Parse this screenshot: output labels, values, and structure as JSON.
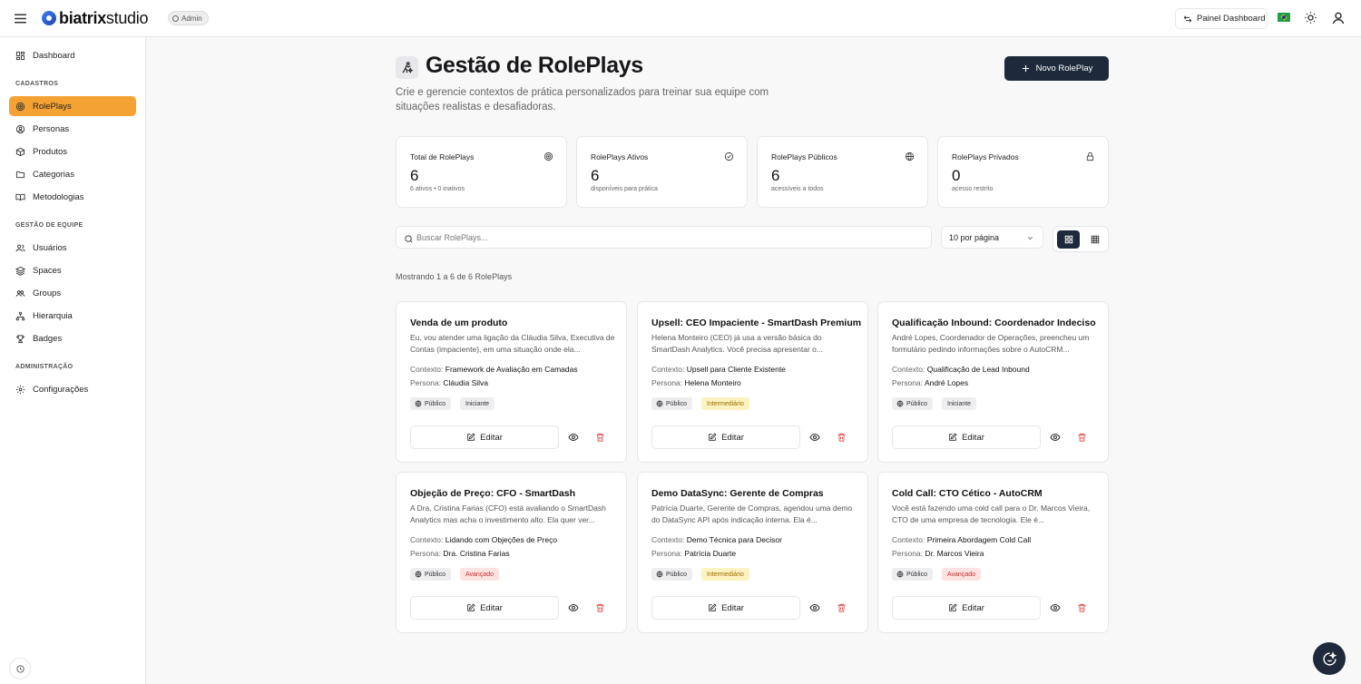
{
  "header": {
    "logo_bold": "biatrix",
    "logo_light": "studio",
    "role_badge": "Admin",
    "painel_label": "Painel Dashboard",
    "icons": [
      "menu-icon",
      "swap-icon",
      "flag-brazil-icon",
      "sun-icon",
      "user-icon"
    ]
  },
  "sidebar": {
    "dashboard": "Dashboard",
    "sections": {
      "cadastros": "CADASTROS",
      "gestao": "GESTÃO DE EQUIPE",
      "admin": "ADMINISTRAÇÃO"
    },
    "items": [
      {
        "label": "RolePlays",
        "icon": "target-icon",
        "active": true
      },
      {
        "label": "Personas",
        "icon": "persona-icon"
      },
      {
        "label": "Produtos",
        "icon": "package-icon"
      },
      {
        "label": "Categorias",
        "icon": "folder-icon"
      },
      {
        "label": "Metodologias",
        "icon": "book-icon"
      },
      {
        "label": "Usuários",
        "icon": "users-icon"
      },
      {
        "label": "Spaces",
        "icon": "layers-icon"
      },
      {
        "label": "Groups",
        "icon": "groups-icon"
      },
      {
        "label": "Hierarquia",
        "icon": "network-icon"
      },
      {
        "label": "Badges",
        "icon": "trophy-icon"
      },
      {
        "label": "Configurações",
        "icon": "gear-icon"
      }
    ]
  },
  "page": {
    "title": "Gestão de RolePlays",
    "subtitle": "Crie e gerencie contextos de prática personalizados para treinar sua equipe com situações realistas e desafiadoras.",
    "new_button": "Novo RolePlay"
  },
  "stats": [
    {
      "label": "Total de RolePlays",
      "value": "6",
      "sub": "6 ativos • 0 inativos",
      "icon": "target-icon"
    },
    {
      "label": "RolePlays Ativos",
      "value": "6",
      "sub": "disponíveis para prática",
      "icon": "check-circle-icon"
    },
    {
      "label": "RolePlays Públicos",
      "value": "6",
      "sub": "acessíveis a todos",
      "icon": "globe-icon"
    },
    {
      "label": "RolePlays Privados",
      "value": "0",
      "sub": "acesso restrito",
      "icon": "lock-icon"
    }
  ],
  "filters": {
    "search_placeholder": "Buscar RolePlays...",
    "per_page": "10 por página",
    "showing": "Mostrando 1 a 6 de 6 RolePlays"
  },
  "labels": {
    "contexto": "Contexto:",
    "persona": "Persona:",
    "edit": "Editar",
    "public": "Público"
  },
  "cards": [
    {
      "title": "Venda de um produto",
      "description": "Eu, vou atender uma ligação da Cláudia Silva, Executiva de Contas (impaciente), em uma situação onde ela...",
      "context": "Framework de Avaliação em Camadas",
      "persona": "Cláudia Silva",
      "visibility": "Público",
      "level": "Iniciante",
      "level_kind": "ini"
    },
    {
      "title": "Upsell: CEO Impaciente - SmartDash Premium",
      "description": "Helena Monteiro (CEO) já usa a versão básica do SmartDash Analytics. Você precisa apresentar o...",
      "context": "Upsell para Cliente Existente",
      "persona": "Helena Monteiro",
      "visibility": "Público",
      "level": "Intermediário",
      "level_kind": "int"
    },
    {
      "title": "Qualificação Inbound: Coordenador Indeciso",
      "description": "André Lopes, Coordenador de Operações, preencheu um formulário pedindo informações sobre o AutoCRM...",
      "context": "Qualificação de Lead Inbound",
      "persona": "André Lopes",
      "visibility": "Público",
      "level": "Iniciante",
      "level_kind": "ini"
    },
    {
      "title": "Objeção de Preço: CFO - SmartDash",
      "description": "A Dra. Cristina Farias (CFO) está avaliando o SmartDash Analytics mas acha o investimento alto. Ela quer ver...",
      "context": "Lidando com Objeções de Preço",
      "persona": "Dra. Cristina Farias",
      "visibility": "Público",
      "level": "Avançado",
      "level_kind": "adv"
    },
    {
      "title": "Demo DataSync: Gerente de Compras",
      "description": "Patrícia Duarte, Gerente de Compras, agendou uma demo do DataSync API após indicação interna. Ela é...",
      "context": "Demo Técnica para Decisor",
      "persona": "Patrícia Duarte",
      "visibility": "Público",
      "level": "Intermediário",
      "level_kind": "int"
    },
    {
      "title": "Cold Call: CTO Cético - AutoCRM",
      "description": "Você está fazendo uma cold call para o Dr. Marcos Vieira, CTO de uma empresa de tecnologia. Ele é...",
      "context": "Primeira Abordagem Cold Call",
      "persona": "Dr. Marcos Vieira",
      "visibility": "Público",
      "level": "Avançado",
      "level_kind": "adv"
    }
  ]
}
